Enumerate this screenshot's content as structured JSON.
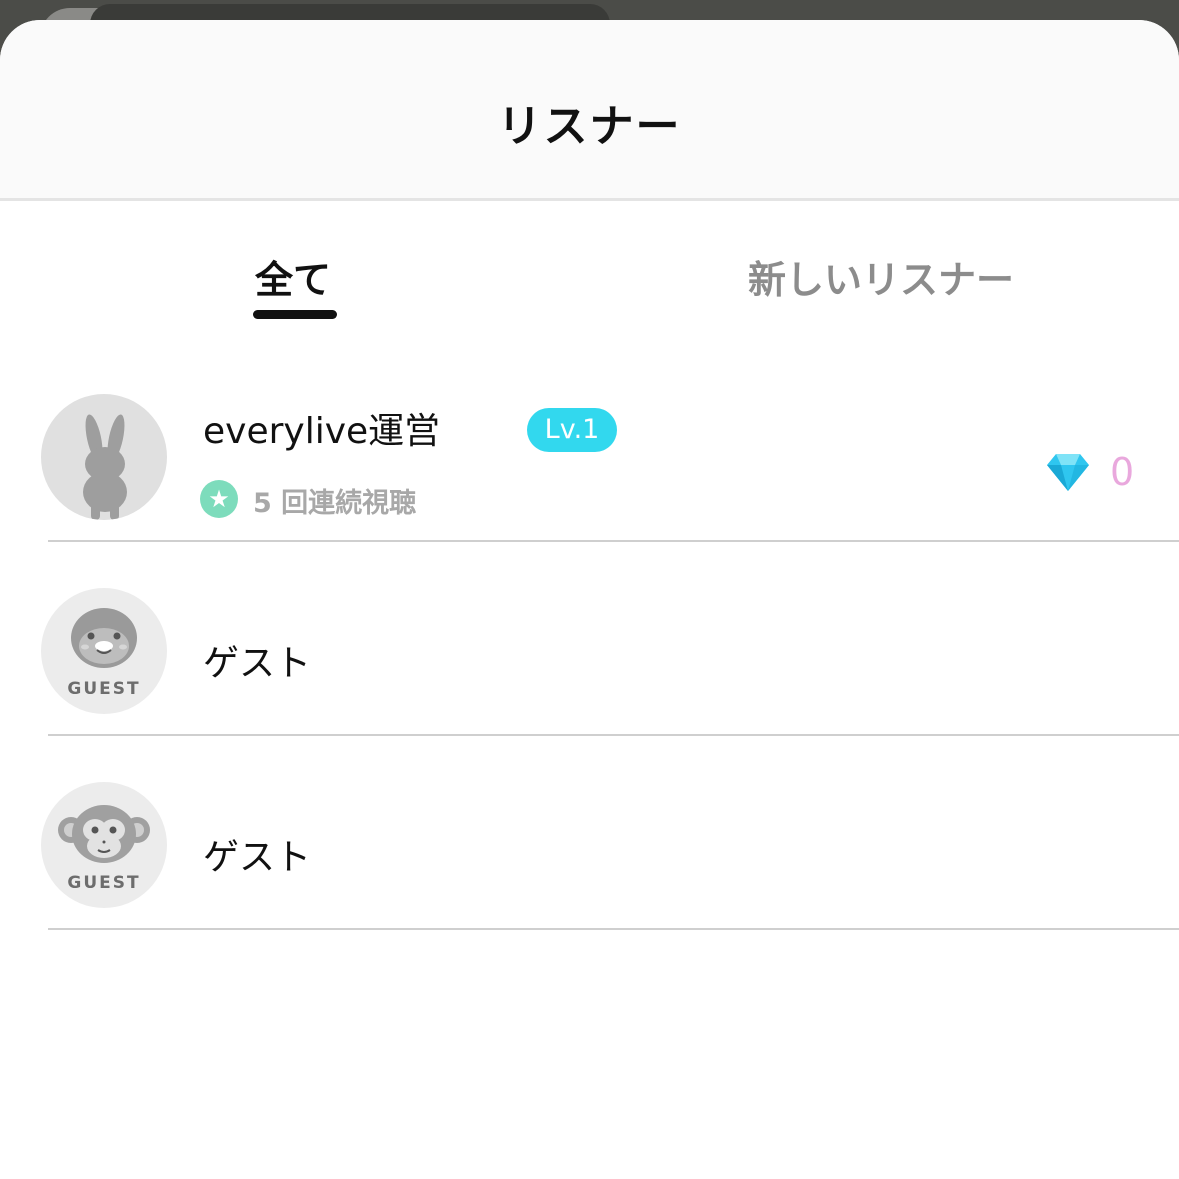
{
  "sheet": {
    "title": "リスナー"
  },
  "tabs": [
    {
      "label": "全て",
      "active": true
    },
    {
      "label": "新しいリスナー",
      "active": false
    }
  ],
  "listeners": [
    {
      "name": "everylive運営",
      "level": "Lv.1",
      "streak": "5 回連続視聴",
      "streak_icon": "star-icon",
      "avatar_icon": "rabbit-silhouette-icon",
      "diamonds": "0",
      "diamond_icon": "diamond-icon"
    },
    {
      "name": "ゲスト",
      "avatar_icon": "penguin-guest-icon",
      "avatar_caption": "GUEST"
    },
    {
      "name": "ゲスト",
      "avatar_icon": "monkey-guest-icon",
      "avatar_caption": "GUEST"
    }
  ],
  "colors": {
    "level_badge": "#32d8ee",
    "streak_icon": "#7ddcbc",
    "diamond": "#2fc6ef",
    "diamond_count": "#e9a8dd",
    "active_tab": "#111111",
    "inactive_tab": "#8c8c8c"
  }
}
